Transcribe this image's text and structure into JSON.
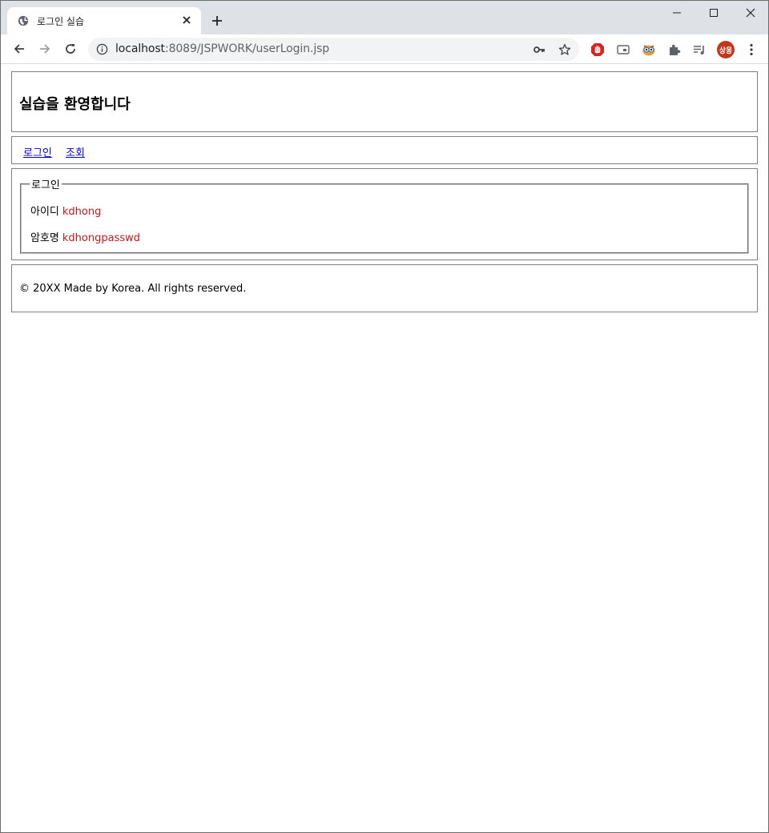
{
  "browser": {
    "tab_title": "로그인 실습",
    "url_host": "localhost",
    "url_rest": ":8089/JSPWORK/userLogin.jsp",
    "profile_initials": "상옹",
    "colors": {
      "titlebar": "#dee1e6",
      "omnibox": "#f1f3f4",
      "profile": "#c0391b",
      "adblock": "#d9231e"
    }
  },
  "page": {
    "title": "실습을 환영합니다",
    "nav": [
      {
        "label": "로그인"
      },
      {
        "label": "조회"
      }
    ],
    "login": {
      "legend": "로그인",
      "fields": [
        {
          "label": "아이디",
          "value": "kdhong"
        },
        {
          "label": "암호명",
          "value": "kdhongpasswd"
        }
      ],
      "value_color": "#c41a1a"
    },
    "footer": "© 20XX Made by Korea. All rights reserved."
  }
}
